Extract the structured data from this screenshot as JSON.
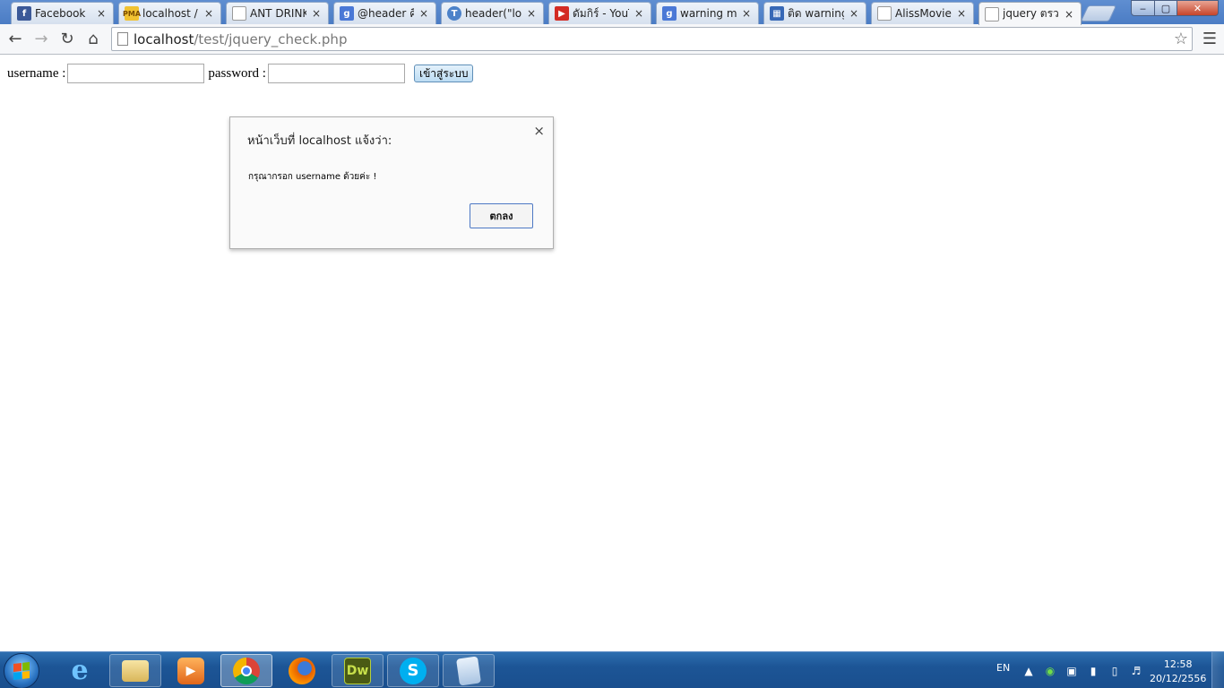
{
  "browser": {
    "tabs": [
      {
        "label": "Facebook",
        "icon": "facebook-icon",
        "close": "×"
      },
      {
        "label": "localhost / lo",
        "icon": "phpmyadmin-icon",
        "close": "×"
      },
      {
        "label": "ANT DRINK",
        "icon": "page-icon",
        "close": "×"
      },
      {
        "label": "@header คือ",
        "icon": "google-icon",
        "close": "×"
      },
      {
        "label": "header(\"loca",
        "icon": "tsb-icon",
        "close": "×"
      },
      {
        "label": "ดัมกิร์ - YouT",
        "icon": "youtube-icon",
        "close": "×"
      },
      {
        "label": "warning mys",
        "icon": "google-icon",
        "close": "×"
      },
      {
        "label": "ติด warning r",
        "icon": "site-icon",
        "close": "×"
      },
      {
        "label": "AlissMovie ก",
        "icon": "page-icon",
        "close": "×"
      },
      {
        "label": "jquery ตรวจ",
        "icon": "page-icon",
        "close": "×"
      }
    ],
    "window_controls": {
      "minimize": "‒",
      "maximize": "▢",
      "close": "✕"
    },
    "url": {
      "host": "localhost",
      "path": "/test/jquery_check.php"
    }
  },
  "form": {
    "username_label": "username :",
    "password_label": "password :",
    "username_value": "",
    "password_value": "",
    "submit_label": "เข้าสู่ระบบ"
  },
  "alert": {
    "title": "หน้าเว็บที่ localhost แจ้งว่า:",
    "message": "กรุณากรอก username ด้วยค่ะ !",
    "ok_label": "ตกลง",
    "close": "×"
  },
  "taskbar": {
    "apps": [
      {
        "name": "internet-explorer",
        "label": "e"
      },
      {
        "name": "file-explorer",
        "label": ""
      },
      {
        "name": "media-player",
        "label": "▶"
      },
      {
        "name": "chrome",
        "label": ""
      },
      {
        "name": "firefox",
        "label": ""
      },
      {
        "name": "dreamweaver",
        "label": "Dw"
      },
      {
        "name": "skype",
        "label": "S"
      },
      {
        "name": "notepad",
        "label": ""
      }
    ],
    "tray": {
      "language": "EN",
      "time": "12:58",
      "date": "20/12/2556"
    }
  }
}
